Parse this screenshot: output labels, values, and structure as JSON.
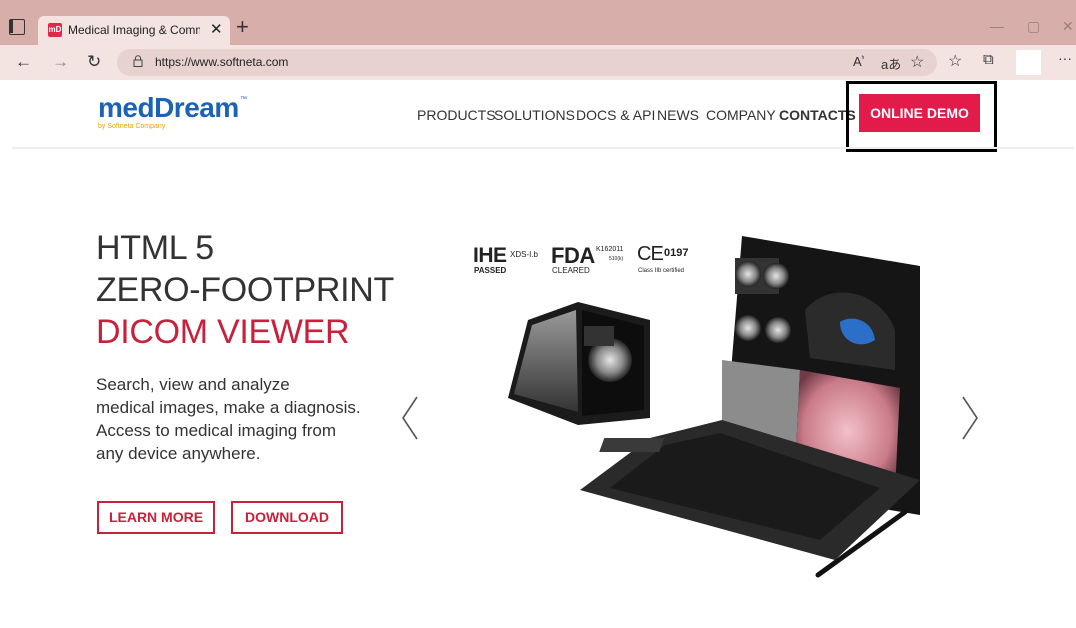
{
  "browser": {
    "tab_title": "Medical Imaging & Communicati",
    "favicon_text": "mD",
    "url": "https://www.softneta.com"
  },
  "site": {
    "logo_primary": "medDream",
    "logo_tm": "™",
    "logo_sub": "by Softneta Company",
    "nav": [
      "PRODUCTS",
      "SOLUTIONS",
      "DOCS & API",
      "NEWS",
      "COMPANY",
      "CONTACTS"
    ],
    "cta": "ONLINE DEMO",
    "accent_color": "#e31b4a",
    "brand_blue": "#1c62b5"
  },
  "hero": {
    "line1": "HTML 5",
    "line2": "ZERO-FOOTPRINT",
    "line3": "DICOM VIEWER",
    "description": [
      "Search, view and analyze",
      "medical images, make a diagnosis.",
      "Access to medical imaging from",
      "any device anywhere."
    ],
    "learn_more": "LEARN MORE",
    "download": "DOWNLOAD"
  },
  "certifications": {
    "ihe": "IHE",
    "ihe_sup": "XDS-I.b",
    "ihe_sub": "PASSED",
    "fda": "FDA",
    "fda_sup": "K162011",
    "fda_sup2": "510(k)",
    "fda_sub": "CLEARED",
    "ce": "CE",
    "ce_num": "0197",
    "ce_sub": "Class IIb certified"
  }
}
